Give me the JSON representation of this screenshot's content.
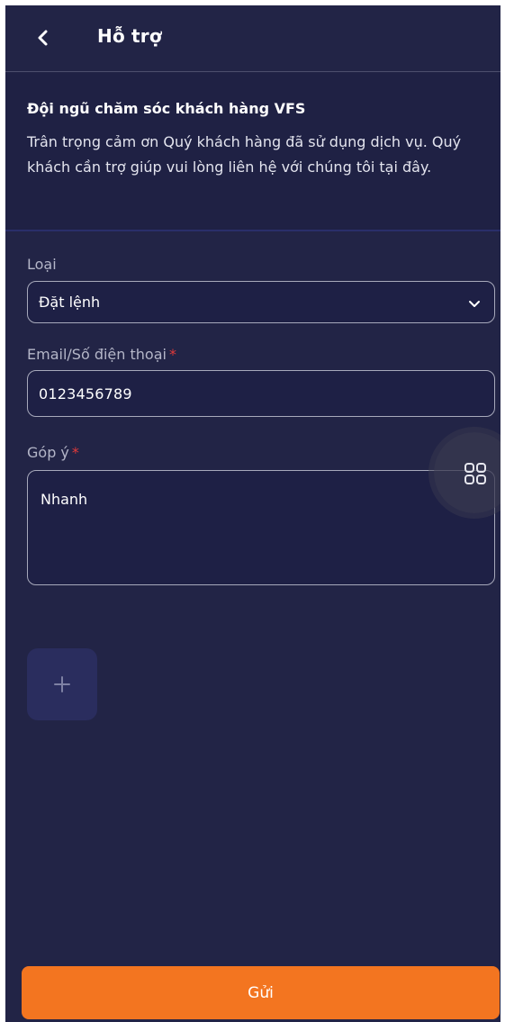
{
  "header": {
    "title": "Hỗ trợ",
    "back_icon": "chevron-left-icon"
  },
  "intro": {
    "title": "Đội ngũ chăm sóc khách hàng VFS",
    "description": "Trân trọng cảm ơn Quý khách hàng đã sử dụng dịch vụ. Quý khách cần trợ giúp vui lòng liên hệ với chúng tôi tại đây."
  },
  "form": {
    "type_label": "Loại",
    "type_value": "Đặt lệnh",
    "contact_label": "Email/Số điện thoại",
    "contact_value": "0123456789",
    "feedback_label": "Góp ý",
    "feedback_value": "Nhanh",
    "required_mark": "*"
  },
  "attachment": {
    "add_icon": "plus-icon"
  },
  "floating_button": {
    "icon": "grid-icon"
  },
  "submit": {
    "label": "Gửi"
  },
  "colors": {
    "background": "#222446",
    "accent": "#f37520",
    "required": "#e23a3a"
  }
}
